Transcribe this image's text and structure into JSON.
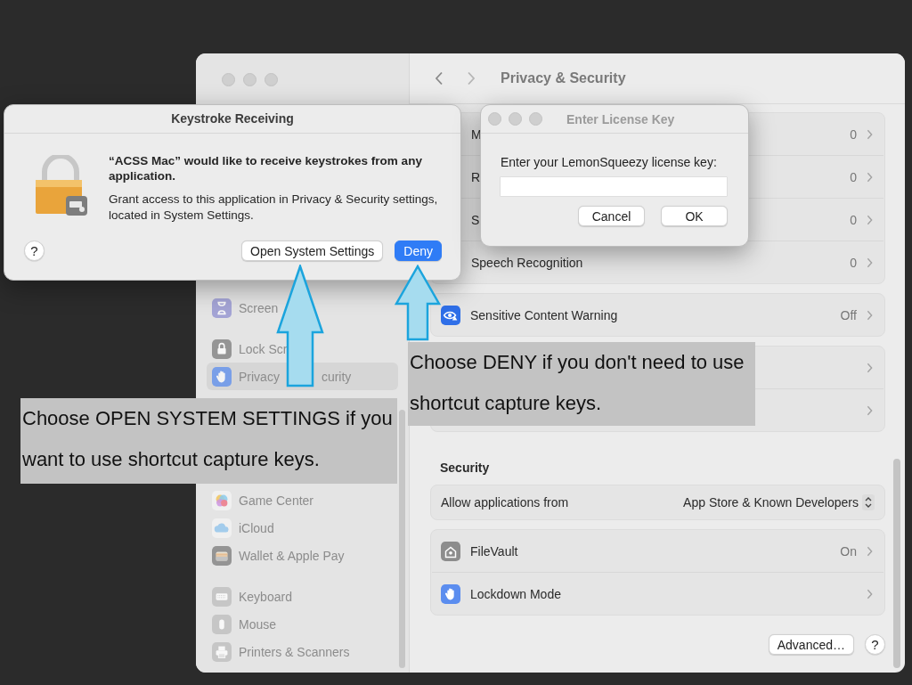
{
  "settings_window": {
    "title": "Privacy & Security",
    "sidebar": {
      "groups": [
        {
          "items": [
            {
              "label": "Screen",
              "selected": false
            }
          ]
        },
        {
          "items": [
            {
              "label": "Lock Scr",
              "selected": false
            },
            {
              "label": "Privacy",
              "label_after_cover": "curity",
              "selected": true
            }
          ]
        },
        {
          "items": [
            {
              "label": "Game Center",
              "selected": false
            },
            {
              "label": "iCloud",
              "selected": false
            },
            {
              "label": "Wallet & Apple Pay",
              "selected": false
            }
          ]
        },
        {
          "items": [
            {
              "label": "Keyboard",
              "selected": false
            },
            {
              "label": "Mouse",
              "selected": false
            },
            {
              "label": "Printers & Scanners",
              "selected": false
            }
          ]
        }
      ]
    },
    "groups": [
      {
        "rows": [
          {
            "kind": "nav",
            "title": "M",
            "value": "0"
          },
          {
            "kind": "nav",
            "title": "R",
            "value": "0"
          },
          {
            "kind": "nav",
            "title": "S",
            "value": "0"
          },
          {
            "kind": "nav",
            "title": "Speech Recognition",
            "value": "0"
          }
        ]
      },
      {
        "rows": [
          {
            "kind": "nav",
            "title": "Sensitive Content Warning",
            "value": "Off"
          }
        ]
      },
      {
        "rows": [
          {
            "kind": "nav"
          },
          {
            "kind": "nav"
          }
        ]
      },
      {
        "header": "Security",
        "rows": [
          {
            "kind": "popup",
            "title": "Allow applications from",
            "value": "App Store & Known Developers"
          }
        ]
      },
      {
        "rows": [
          {
            "kind": "nav",
            "title": "FileVault",
            "value": "On"
          },
          {
            "kind": "nav",
            "title": "Lockdown Mode"
          }
        ]
      }
    ],
    "footer": {
      "button": "Advanced…",
      "help": "?"
    }
  },
  "keystroke_dialog": {
    "title": "Keystroke Receiving",
    "heading": "“ACSS Mac” would like to receive keystrokes from any application.",
    "message": "Grant access to this application in Privacy & Security settings, located in System Settings.",
    "help": "?",
    "buttons": [
      {
        "label": "Open System Settings",
        "default": false
      },
      {
        "label": "Deny",
        "default": true
      }
    ]
  },
  "license_dialog": {
    "title": "Enter License Key",
    "prompt": "Enter your LemonSqueezy license key:",
    "buttons": [
      {
        "label": "Cancel",
        "default": false
      },
      {
        "label": "OK",
        "default": false
      }
    ]
  },
  "callouts": [
    {
      "text": "Choose OPEN SYSTEM SETTINGS if you want to use shortcut capture keys."
    },
    {
      "text": "Choose DENY if you don't need to use shortcut capture keys."
    }
  ]
}
